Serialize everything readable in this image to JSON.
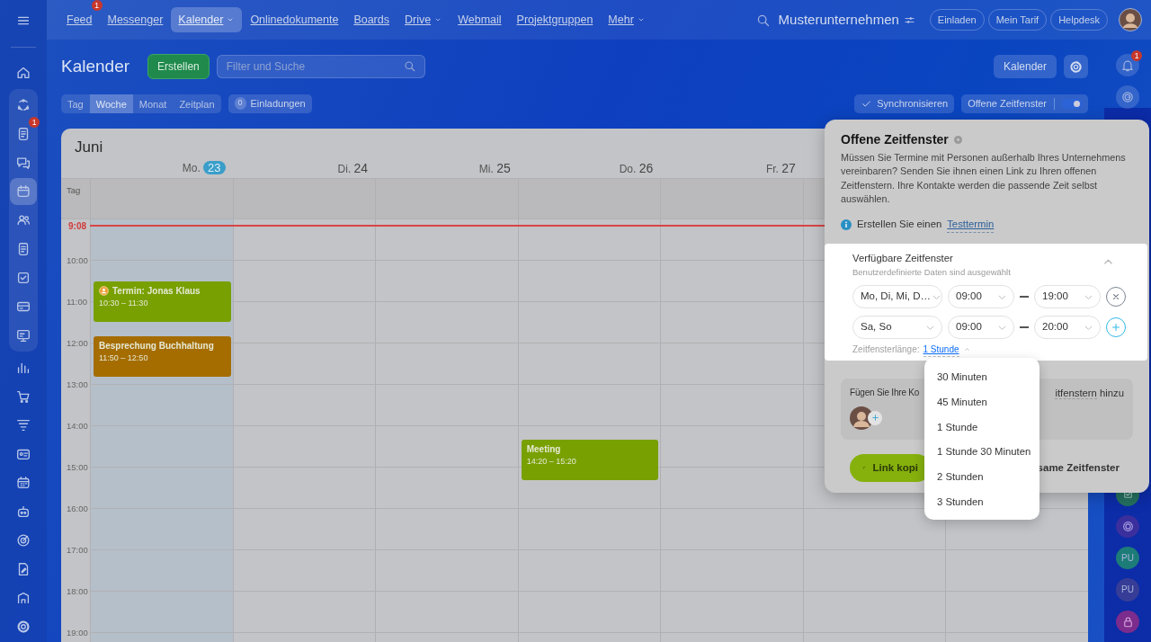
{
  "topbar": {
    "menu": [
      {
        "label": "Feed",
        "selected": false,
        "dropdown": false,
        "badge": "1"
      },
      {
        "label": "Messenger",
        "selected": false,
        "dropdown": false
      },
      {
        "label": "Kalender",
        "selected": true,
        "dropdown": true
      },
      {
        "label": "Onlinedokumente",
        "selected": false,
        "dropdown": false
      },
      {
        "label": "Boards",
        "selected": false,
        "dropdown": false
      },
      {
        "label": "Drive",
        "selected": false,
        "dropdown": true
      },
      {
        "label": "Webmail",
        "selected": false,
        "dropdown": false
      },
      {
        "label": "Projektgruppen",
        "selected": false,
        "dropdown": false
      },
      {
        "label": "Mehr",
        "selected": false,
        "dropdown": true
      }
    ],
    "company": "Musterunternehmen",
    "buttons": [
      "Einladen",
      "Mein Tarif",
      "Helpdesk"
    ]
  },
  "sidebar": {
    "sections": [
      {
        "grouped": false,
        "items": [
          {
            "selected": false
          }
        ]
      },
      {
        "grouped": true,
        "items": [
          {
            "selected": false
          },
          {
            "selected": false,
            "badge": "1"
          },
          {
            "selected": false
          },
          {
            "selected": true
          },
          {
            "selected": false
          },
          {
            "selected": false
          },
          {
            "selected": false
          },
          {
            "selected": false
          },
          {
            "selected": false
          }
        ]
      },
      {
        "grouped": false,
        "items": [
          {
            "selected": false
          },
          {
            "selected": false
          },
          {
            "selected": false
          },
          {
            "selected": false
          },
          {
            "selected": false
          },
          {
            "selected": false
          },
          {
            "selected": false
          },
          {
            "selected": false
          },
          {
            "selected": false
          },
          {
            "selected": false
          }
        ]
      }
    ]
  },
  "page": {
    "title": "Kalender",
    "create_button": "Erstellen",
    "search": {
      "placeholder": "Filter und Suche"
    },
    "views": [
      {
        "label": "Tag",
        "selected": false
      },
      {
        "label": "Woche",
        "selected": true
      },
      {
        "label": "Monat",
        "selected": false
      },
      {
        "label": "Zeitplan",
        "selected": false
      }
    ],
    "invitations": {
      "count": "0",
      "label": "Einladungen"
    },
    "calendar_button": "Kalender",
    "sync": {
      "label": "Synchronisieren",
      "checked": true
    },
    "open_slots": {
      "label": "Offene Zeitfenster",
      "on": true
    }
  },
  "calendar": {
    "month": "Juni",
    "allday_label": "Tag",
    "now": "9:08",
    "days": [
      {
        "weekday": "Mo.",
        "date": "23",
        "today": true,
        "events": [
          {
            "kind": "booking",
            "title": "Termin: Jonas Klaus",
            "time": "10:30 – 11:30",
            "color": "#78a000"
          },
          {
            "kind": "event",
            "title": "Besprechung Buchhaltung",
            "time": "11:50 – 12:50",
            "color": "#a56d00"
          }
        ]
      },
      {
        "weekday": "Di.",
        "date": "24",
        "today": false
      },
      {
        "weekday": "Mi.",
        "date": "25",
        "today": false
      },
      {
        "weekday": "Do.",
        "date": "26",
        "today": false,
        "events": [
          {
            "kind": "event",
            "title": "Meeting",
            "time": "14:20 – 15:20",
            "color": "#78a000"
          }
        ]
      },
      {
        "weekday": "Fr.",
        "date": "27",
        "today": false
      }
    ],
    "hours": [
      "10:00",
      "11:00",
      "12:00",
      "13:00",
      "14:00",
      "15:00",
      "16:00",
      "17:00",
      "18:00",
      "19:00"
    ]
  },
  "popover": {
    "title": "Offene Zeitfenster",
    "text": "Müssen Sie Termine mit Personen außerhalb Ihres Unternehmens vereinbaren? Senden Sie ihnen einen Link zu Ihren offenen Zeitfenstern. Ihre Kontakte werden die passende Zeit selbst auswählen.",
    "info_text": "Erstellen Sie einen",
    "info_link": "Testtermin",
    "slots": {
      "title": "Verfügbare Zeitfenster",
      "subtitle": "Benutzerdefinierte Daten sind ausgewählt",
      "expanded": true,
      "rows": [
        {
          "days": "Mo, Di, Mi, D…",
          "from": "09:00",
          "to": "19:00",
          "kind": "remove"
        },
        {
          "days": "Sa, So",
          "from": "09:00",
          "to": "20:00",
          "kind": "add"
        }
      ],
      "length_label": "Zeitfensterlänge:",
      "length_value": "1 Stunde"
    },
    "colleagues": {
      "text_start": "Fügen Sie Ihre Ko",
      "link_end": "itfenstern",
      "text_end": "hinzu"
    },
    "copy_button": "Link kopi",
    "shared_link": "same Zeitfenster"
  },
  "length_menu": {
    "options": [
      "30 Minuten",
      "45 Minuten",
      "1 Stunde",
      "1 Stunde 30 Minuten",
      "2 Stunden",
      "3 Stunden"
    ]
  },
  "rail": {
    "notifications_badge": "1",
    "groups": [
      {
        "label": "PU",
        "color": "#1d7c78"
      },
      {
        "label": "PU",
        "color": "#373d96"
      }
    ]
  }
}
